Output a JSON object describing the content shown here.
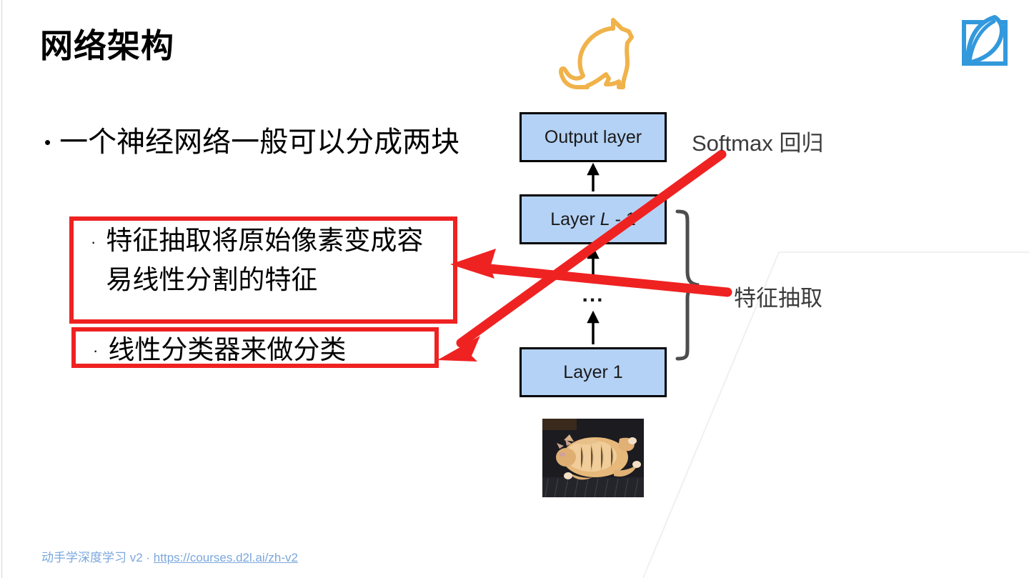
{
  "slide": {
    "title": "网络架构",
    "background_color": "#ffffff"
  },
  "logo": {
    "name": "d2l-logo",
    "color": "#3399dd"
  },
  "illustrations": {
    "cat_outline": {
      "name": "cat-outline-drawing",
      "color": "#f0b24a"
    },
    "cat_photo": {
      "name": "cat-photo",
      "description": "orange cat lying on back on dark carpet"
    }
  },
  "content": {
    "bullet_main": {
      "marker": "•",
      "text": "一个神经网络一般可以分成两块"
    },
    "sub_bullets": [
      {
        "marker": "·",
        "text": "特征抽取将原始像素变成容易线性分割的特征",
        "highlight_color": "#ef2222"
      },
      {
        "marker": "·",
        "text": "线性分类器来做分类",
        "highlight_color": "#ef2222"
      }
    ]
  },
  "diagram": {
    "box_fill": "#b4d2f5",
    "box_border": "#000000",
    "layers": [
      {
        "label": "Output layer",
        "italic_part": ""
      },
      {
        "label_prefix": "Layer ",
        "italic_part": "L",
        "label_suffix": " - 1"
      },
      {
        "label": "Layer 1",
        "italic_part": ""
      }
    ],
    "ellipsis": "...",
    "brace_color": "#4d4d4d"
  },
  "annotations": [
    {
      "id": "softmax",
      "text": "Softmax 回归",
      "arrow_color": "#ef2222",
      "points_to": "线性分类器来做分类"
    },
    {
      "id": "feature",
      "text": "特征抽取",
      "arrow_color": "#ef2222",
      "points_to": "特征抽取将原始像素变成容易线性分割的特征"
    }
  ],
  "footer": {
    "text": "动手学深度学习 v2 · ",
    "link_text": "https://courses.d2l.ai/zh-v2",
    "color": "#7ba7dd"
  }
}
